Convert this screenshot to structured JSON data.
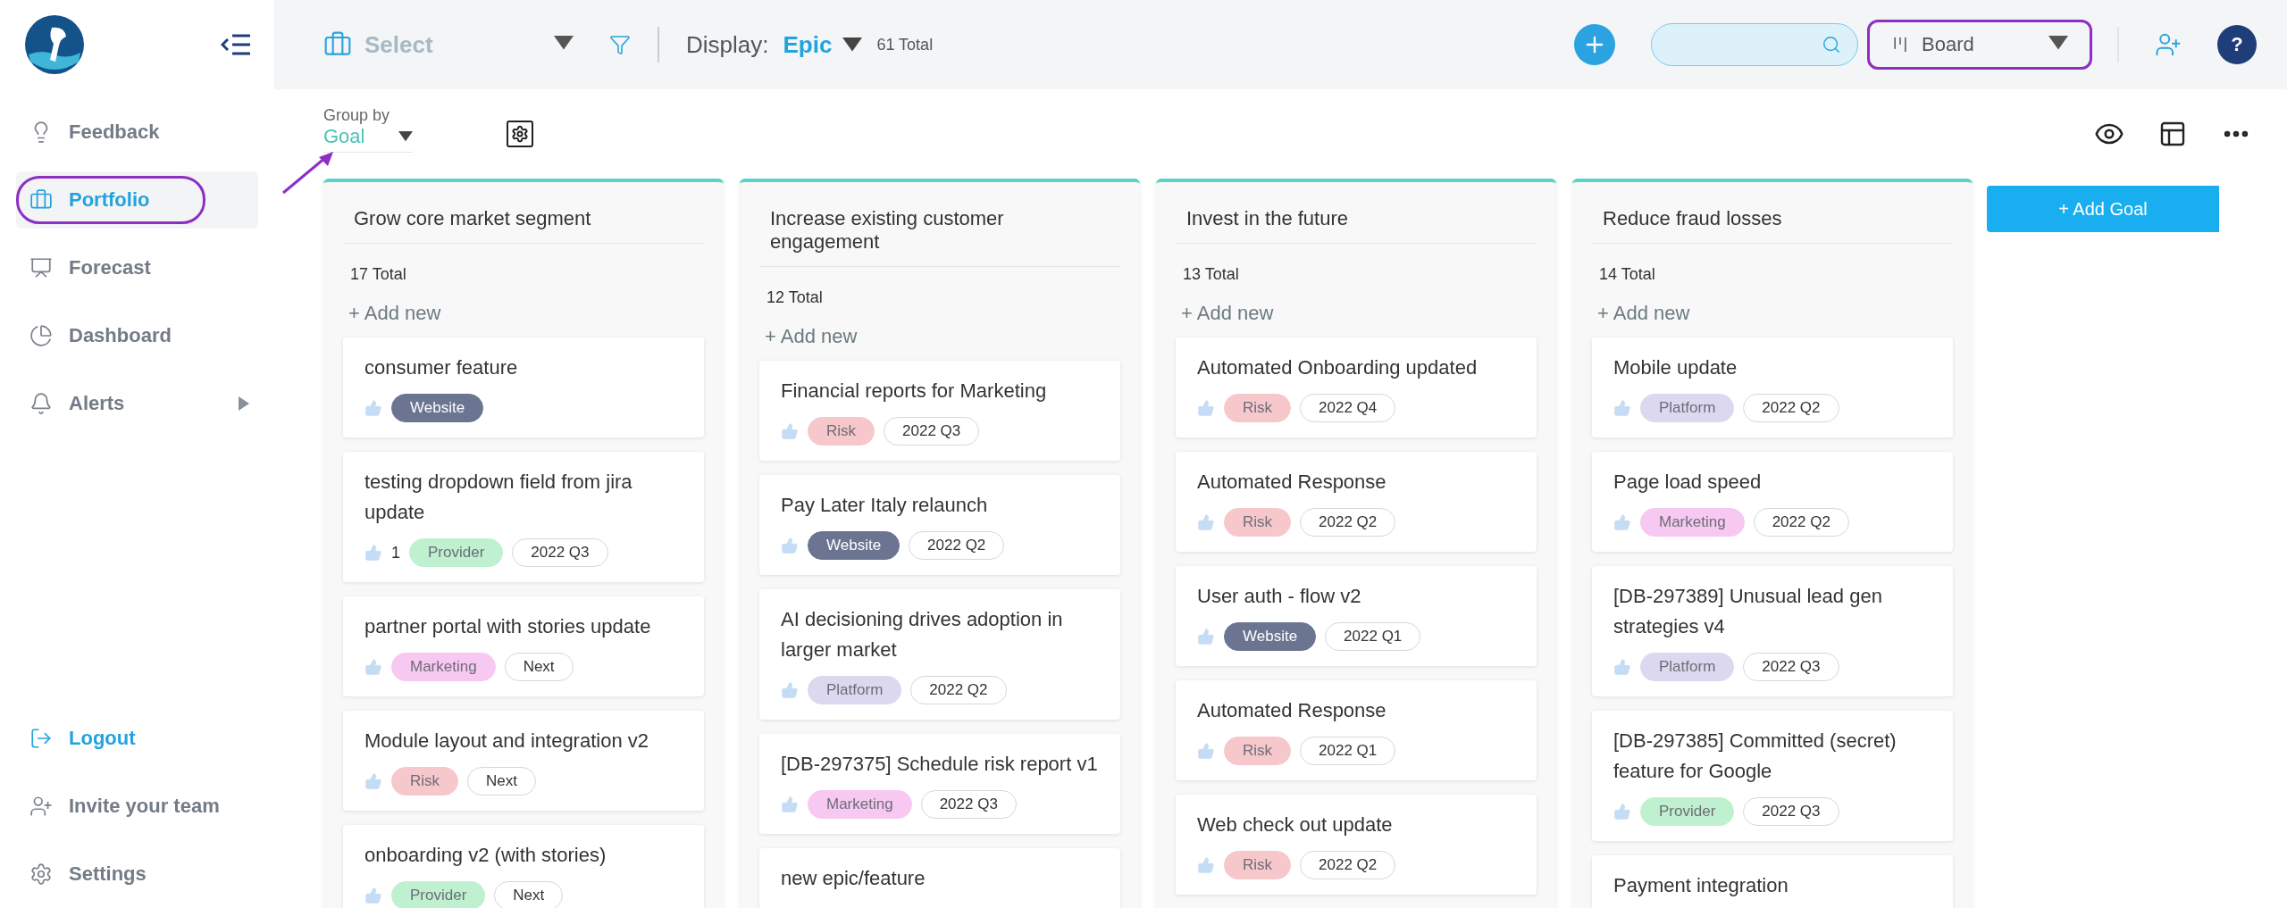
{
  "sidebar": {
    "items": [
      {
        "label": "Feedback",
        "selected": false,
        "circled": false,
        "has_submenu": false
      },
      {
        "label": "Portfolio",
        "selected": true,
        "circled": true,
        "has_submenu": false
      },
      {
        "label": "Forecast",
        "selected": false,
        "circled": false,
        "has_submenu": false
      },
      {
        "label": "Dashboard",
        "selected": false,
        "circled": false,
        "has_submenu": false
      },
      {
        "label": "Alerts",
        "selected": false,
        "circled": false,
        "has_submenu": true
      }
    ],
    "bottom_items": [
      {
        "label": "Logout",
        "kind": "accent"
      },
      {
        "label": "Invite your team",
        "kind": "plain"
      },
      {
        "label": "Settings",
        "kind": "plain"
      }
    ]
  },
  "topbar": {
    "select_value": "Select",
    "display_label": "Display:",
    "display_value": "Epic",
    "total": "61 Total",
    "view": "Board",
    "view_circled": true,
    "help_label": "?"
  },
  "toolbar": {
    "group_by_label": "Group by",
    "group_by_value": "Goal"
  },
  "columns": [
    {
      "title": "Grow core market segment",
      "total": "17 Total",
      "add_label": "+ Add new",
      "cards": [
        {
          "title": "consumer feature",
          "tags": [
            {
              "kind": "category",
              "label": "Website",
              "color": "#6b7592"
            }
          ]
        },
        {
          "title": "testing dropdown field from jira update",
          "likes": "1",
          "tags": [
            {
              "kind": "category",
              "label": "Provider",
              "color": "#bff0cf"
            },
            {
              "kind": "period",
              "label": "2022 Q3"
            }
          ]
        },
        {
          "title": "partner portal with stories update",
          "tags": [
            {
              "kind": "category",
              "label": "Marketing",
              "color": "#f7c8f1"
            },
            {
              "kind": "period",
              "label": "Next"
            }
          ]
        },
        {
          "title": "Module layout and integration v2",
          "tags": [
            {
              "kind": "category",
              "label": "Risk",
              "color": "#f6c7cb"
            },
            {
              "kind": "period",
              "label": "Next"
            }
          ]
        },
        {
          "title": "onboarding v2 (with stories)",
          "tags": [
            {
              "kind": "category",
              "label": "Provider",
              "color": "#bff0cf"
            },
            {
              "kind": "period",
              "label": "Next"
            }
          ]
        }
      ]
    },
    {
      "title": "Increase existing customer engagement",
      "total": "12 Total",
      "add_label": "+ Add new",
      "cards": [
        {
          "title": "Financial reports for Marketing",
          "tags": [
            {
              "kind": "category",
              "label": "Risk",
              "color": "#f6c7cb"
            },
            {
              "kind": "period",
              "label": "2022 Q3"
            }
          ]
        },
        {
          "title": "Pay Later Italy relaunch",
          "tags": [
            {
              "kind": "category",
              "label": "Website",
              "color": "#6b7592"
            },
            {
              "kind": "period",
              "label": "2022 Q2"
            }
          ]
        },
        {
          "title": "AI decisioning drives adoption in larger market",
          "tags": [
            {
              "kind": "category",
              "label": "Platform",
              "color": "#dcd8ef"
            },
            {
              "kind": "period",
              "label": "2022 Q2"
            }
          ]
        },
        {
          "title": "[DB-297375] Schedule risk report v1",
          "tags": [
            {
              "kind": "category",
              "label": "Marketing",
              "color": "#f7c8f1"
            },
            {
              "kind": "period",
              "label": "2022 Q3"
            }
          ]
        },
        {
          "title": "new epic/feature"
        }
      ]
    },
    {
      "title": "Invest in the future",
      "total": "13 Total",
      "add_label": "+ Add new",
      "cards": [
        {
          "title": "Automated Onboarding updated",
          "tags": [
            {
              "kind": "category",
              "label": "Risk",
              "color": "#f6c7cb"
            },
            {
              "kind": "period",
              "label": "2022 Q4"
            }
          ]
        },
        {
          "title": "Automated Response",
          "tags": [
            {
              "kind": "category",
              "label": "Risk",
              "color": "#f6c7cb"
            },
            {
              "kind": "period",
              "label": "2022 Q2"
            }
          ]
        },
        {
          "title": "User auth - flow v2",
          "tags": [
            {
              "kind": "category",
              "label": "Website",
              "color": "#6b7592"
            },
            {
              "kind": "period",
              "label": "2022 Q1"
            }
          ]
        },
        {
          "title": "Automated Response",
          "tags": [
            {
              "kind": "category",
              "label": "Risk",
              "color": "#f6c7cb"
            },
            {
              "kind": "period",
              "label": "2022 Q1"
            }
          ]
        },
        {
          "title": "Web check out update",
          "tags": [
            {
              "kind": "category",
              "label": "Risk",
              "color": "#f6c7cb"
            },
            {
              "kind": "period",
              "label": "2022 Q2"
            }
          ]
        }
      ]
    },
    {
      "title": "Reduce fraud losses",
      "total": "14 Total",
      "add_label": "+ Add new",
      "cards": [
        {
          "title": "Mobile update",
          "tags": [
            {
              "kind": "category",
              "label": "Platform",
              "color": "#dcd8ef"
            },
            {
              "kind": "period",
              "label": "2022 Q2"
            }
          ]
        },
        {
          "title": "Page load speed",
          "tags": [
            {
              "kind": "category",
              "label": "Marketing",
              "color": "#f7c8f1"
            },
            {
              "kind": "period",
              "label": "2022 Q2"
            }
          ]
        },
        {
          "title": "[DB-297389] Unusual lead gen strategies v4",
          "tags": [
            {
              "kind": "category",
              "label": "Platform",
              "color": "#dcd8ef"
            },
            {
              "kind": "period",
              "label": "2022 Q3"
            }
          ]
        },
        {
          "title": "[DB-297385] Committed (secret) feature for Google",
          "tags": [
            {
              "kind": "category",
              "label": "Provider",
              "color": "#bff0cf"
            },
            {
              "kind": "period",
              "label": "2022 Q3"
            }
          ]
        },
        {
          "title": "Payment integration"
        }
      ]
    }
  ],
  "add_goal": "+ Add Goal"
}
